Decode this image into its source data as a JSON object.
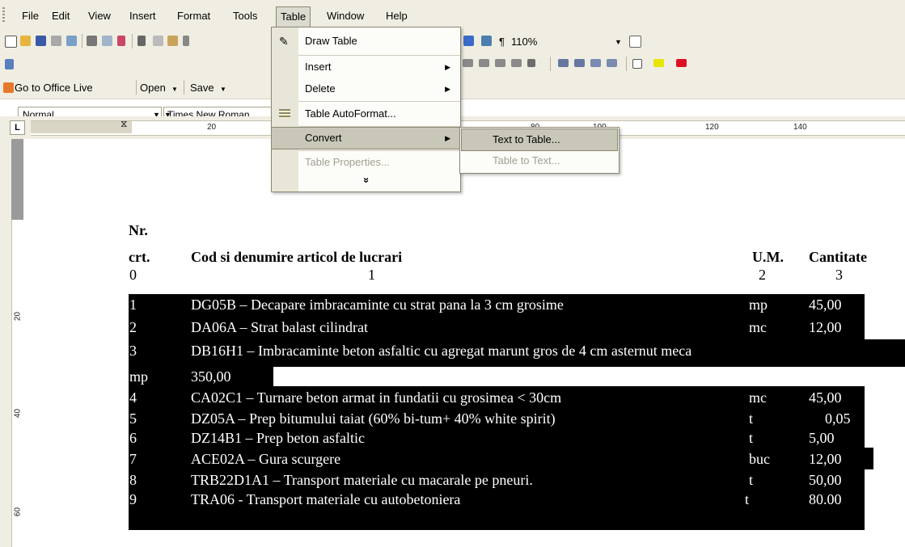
{
  "menubar": {
    "items": [
      "File",
      "Edit",
      "View",
      "Insert",
      "Format",
      "Tools",
      "Table",
      "Window",
      "Help"
    ],
    "open_menu": "Table"
  },
  "toolbar": {
    "zoom": "110%",
    "pilcrow": "¶",
    "style": "Normal",
    "font": "Times New Roman",
    "office_live": "Go to Office Live",
    "open": "Open",
    "save": "Save"
  },
  "ruler": {
    "tab_marker": "L",
    "h_labels": [
      "20",
      "80",
      "100",
      "120",
      "140"
    ],
    "v_labels": [
      "20",
      "40",
      "60"
    ]
  },
  "table_menu": {
    "items": [
      {
        "label": "Draw Table",
        "icon": "pencil-icon",
        "state": "enabled"
      },
      {
        "label": "Insert",
        "submenu": true,
        "state": "enabled"
      },
      {
        "label": "Delete",
        "submenu": true,
        "state": "enabled"
      },
      {
        "label": "Table AutoFormat...",
        "icon": "autoformat-icon",
        "state": "enabled"
      },
      {
        "label": "Convert",
        "submenu": true,
        "state": "highlighted"
      },
      {
        "label": "Table Properties...",
        "state": "disabled"
      },
      {
        "label": "»",
        "state": "expand"
      }
    ]
  },
  "convert_submenu": {
    "items": [
      {
        "label": "Text to Table...",
        "state": "highlighted"
      },
      {
        "label": "Table to Text...",
        "state": "disabled"
      }
    ]
  },
  "document": {
    "header": {
      "nr": "Nr.",
      "crt": "crt.",
      "cod": "Cod si denumire articol de lucrari",
      "um": "U.M.",
      "cantitate": "Cantitate"
    },
    "colnums": [
      "0",
      "1",
      "2",
      "3"
    ],
    "rows": [
      {
        "n": "1",
        "desc": "DG05B – Decapare imbracaminte cu strat pana la 3 cm grosime",
        "um": "mp",
        "qty": "45,00"
      },
      {
        "n": "2",
        "desc": "DA06A – Strat balast cilindrat",
        "um": "mc",
        "qty": "12,00"
      },
      {
        "n": "3",
        "desc": "DB16H1 – Imbracaminte beton asfaltic cu agregat marunt gros de 4 cm asternut meca",
        "um": "mp",
        "qty": "350,00"
      },
      {
        "n": "4",
        "desc": "CA02C1 – Turnare beton armat in fundatii cu grosimea  < 30cm",
        "um": "mc",
        "qty": "45,00"
      },
      {
        "n": "5",
        "desc": "DZ05A – Prep bitumului taiat (60% bi-tum+ 40% white spirit)",
        "um": "t",
        "qty": "0,05"
      },
      {
        "n": "6",
        "desc": "DZ14B1 – Prep beton asfaltic",
        "um": "t",
        "qty": "5,00"
      },
      {
        "n": "7",
        "desc": "ACE02A – Gura scurgere",
        "um": "buc",
        "qty": "12,00"
      },
      {
        "n": "8",
        "desc": "TRB22D1A1 – Transport materiale cu macarale pe pneuri.",
        "um": "t",
        "qty": "50,00"
      },
      {
        "n": "9",
        "desc": "TRA06 - Transport materiale cu autobetoniera",
        "um": "t",
        "qty": "80.00"
      }
    ]
  },
  "colors": {
    "chrome": "#f0eee2",
    "menu_highlight": "#c9c7b8",
    "selection": "#000000"
  }
}
